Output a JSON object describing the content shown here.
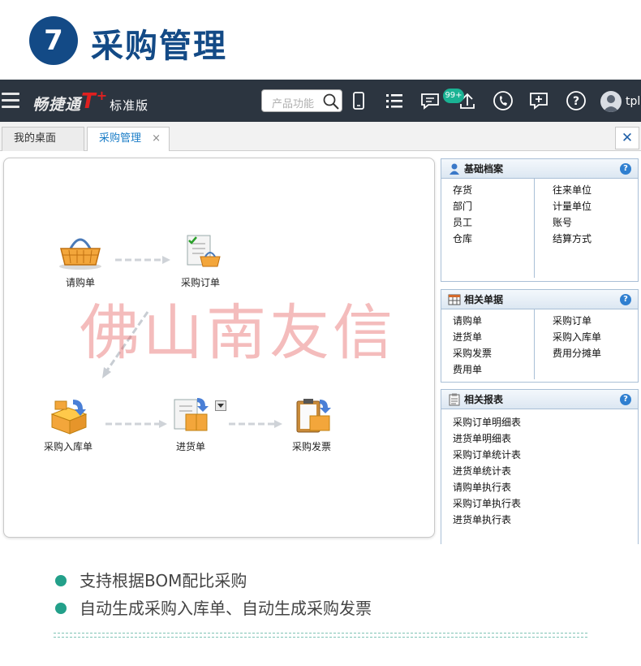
{
  "section": {
    "number": "7",
    "title": "采购管理"
  },
  "topbar": {
    "brand_main": "畅捷通",
    "brand_t": "T",
    "brand_plus": "+",
    "brand_edition": "标准版",
    "search_placeholder": "产品功能",
    "badge": "99+",
    "user": "tplu"
  },
  "tabs": [
    {
      "label": "我的桌面"
    },
    {
      "label": "采购管理",
      "close": "×"
    }
  ],
  "close_all": "✕",
  "flow": {
    "nodes": {
      "requisition": "请购单",
      "purchase_order": "采购订单",
      "purchase_inbound": "采购入库单",
      "receipt": "进货单",
      "purchase_invoice": "采购发票"
    },
    "watermark": "佛山南友信"
  },
  "panels": {
    "basic": {
      "title": "基础档案",
      "left": [
        "存货",
        "部门",
        "员工",
        "仓库"
      ],
      "right": [
        "往来单位",
        "计量单位",
        "账号",
        "结算方式"
      ]
    },
    "docs": {
      "title": "相关单据",
      "left": [
        "请购单",
        "进货单",
        "采购发票",
        "费用单"
      ],
      "right": [
        "采购订单",
        "采购入库单",
        "费用分摊单"
      ]
    },
    "reports": {
      "title": "相关报表",
      "items": [
        "采购订单明细表",
        "进货单明细表",
        "采购订单统计表",
        "进货单统计表",
        "请购单执行表",
        "采购订单执行表",
        "进货单执行表"
      ]
    },
    "help": "?"
  },
  "bullets": [
    "支持根据BOM配比采购",
    "自动生成采购入库单、自动生成采购发票"
  ],
  "colors": {
    "primary": "#134a86",
    "topbar": "#2c3540",
    "accent": "#1a7dc7",
    "bullet": "#23a08a",
    "watermark": "#e15050"
  }
}
